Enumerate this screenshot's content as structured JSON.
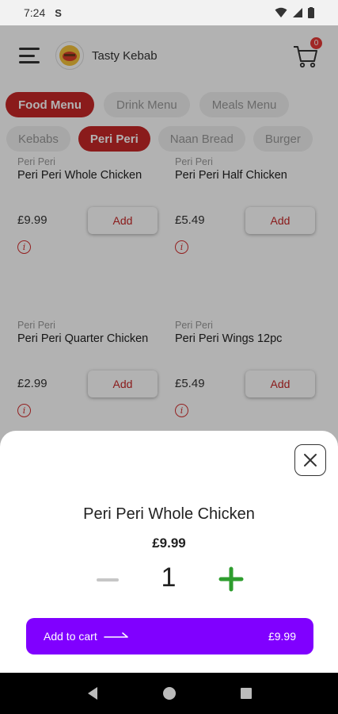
{
  "status": {
    "time": "7:24",
    "s_icon": "S"
  },
  "header": {
    "brand": "Tasty Kebab",
    "cart_count": "0"
  },
  "categories": [
    "Food Menu",
    "Drink Menu",
    "Meals Menu"
  ],
  "active_category": 0,
  "subcategories": [
    "Kebabs",
    "Peri Peri",
    "Naan Bread",
    "Burger"
  ],
  "active_subcategory": 1,
  "products": [
    {
      "category": "Peri Peri",
      "name": "Peri Peri Whole Chicken",
      "price": "£9.99",
      "add_label": "Add"
    },
    {
      "category": "Peri Peri",
      "name": "Peri Peri Half Chicken",
      "price": "£5.49",
      "add_label": "Add"
    },
    {
      "category": "Peri Peri",
      "name": "Peri Peri Quarter Chicken",
      "price": "£2.99",
      "add_label": "Add"
    },
    {
      "category": "Peri Peri",
      "name": "Peri Peri Wings 12pc",
      "price": "£5.49",
      "add_label": "Add"
    }
  ],
  "sheet": {
    "title": "Peri Peri Whole Chicken",
    "price": "£9.99",
    "quantity": "1",
    "add_to_cart_label": "Add to cart",
    "total": "£9.99"
  },
  "colors": {
    "accent": "#c62828",
    "cta": "#8000ff",
    "plus": "#2e9d2e"
  }
}
